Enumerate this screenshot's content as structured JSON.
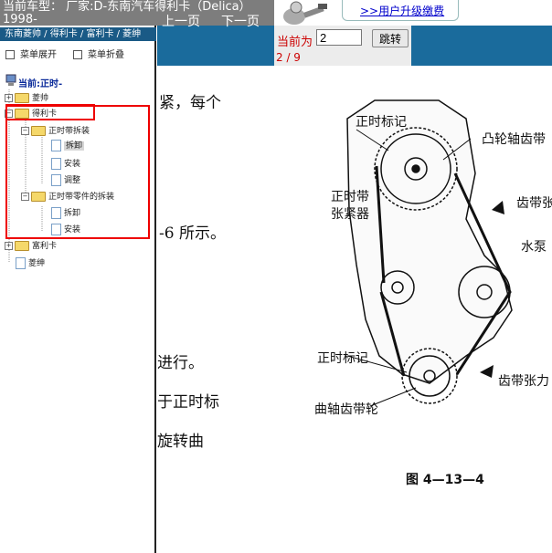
{
  "header": {
    "car_model": "当前车型： 厂家:D-东南汽车得利卡（Delica）1998-",
    "upgrade_link": ">>用户升级缴费"
  },
  "nav": {
    "prev": "上一页",
    "next": "下一页",
    "current_label": "当前为",
    "page_value": "2",
    "jump": "跳转",
    "page_count": "2 / 9"
  },
  "sidebar": {
    "breadcrumb": "东南菱帅 / 得利卡 / 富利卡 / 菱绅",
    "expand_all": "菜单展开",
    "collapse_all": "菜单折叠",
    "current": "当前:正时-",
    "tree": {
      "lingshuai": "菱帅",
      "delica": "得利卡",
      "timing_belt": "正时带拆装",
      "remove": "拆卸",
      "install": "安装",
      "adjust": "调整",
      "timing_parts": "正时带零件的拆装",
      "remove2": "拆卸",
      "install2": "安装",
      "fulika": "富利卡",
      "lingshen": "菱绅"
    }
  },
  "content": {
    "line1": "紧，每个",
    "line2": "-6 所示。",
    "line3": "进行。",
    "line4": "于正时标",
    "line5": "旋转曲",
    "labels": {
      "timing_mark_top": "正时标记",
      "cam_sprocket": "凸轮轴齿带",
      "belt_tensioner": "正时带\n张紧器",
      "toothed_belt": "齿带张",
      "water_pump": "水泵",
      "timing_mark_bottom": "正时标记",
      "belt_tension": "齿带张力",
      "crank_sprocket": "曲轴齿带轮",
      "figure": "图 4—13—4"
    }
  },
  "colors": {
    "nav_blue": "#1a6b9c",
    "header_gray": "#7d7d7d",
    "highlight_red": "#e00000",
    "page_red": "#cc0000"
  }
}
